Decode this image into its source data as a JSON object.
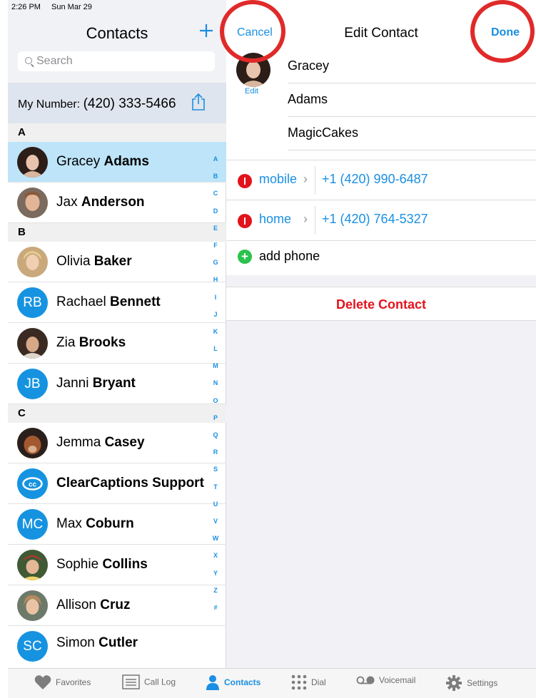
{
  "status_bar": {
    "time": "2:26 PM",
    "date": "Sun Mar 29"
  },
  "left": {
    "title": "Contacts",
    "add_icon": "plus-icon",
    "search_placeholder": "Search",
    "my_number_label": "My Number:",
    "my_number_value": "(420) 333-5466",
    "share_icon": "share-icon",
    "sections": [
      {
        "letter": "A"
      },
      {
        "letter": "B"
      },
      {
        "letter": "C"
      }
    ],
    "contacts": [
      {
        "first": "Gracey",
        "last": "Adams",
        "avatar": "photo",
        "selected": true
      },
      {
        "first": "Jax",
        "last": "Anderson",
        "avatar": "photo"
      },
      {
        "first": "Olivia",
        "last": "Baker",
        "avatar": "photo"
      },
      {
        "first": "Rachael",
        "last": "Bennett",
        "avatar": "RB"
      },
      {
        "first": "Zia",
        "last": "Brooks",
        "avatar": "photo"
      },
      {
        "first": "Janni",
        "last": "Bryant",
        "avatar": "JB"
      },
      {
        "first": "Jemma",
        "last": "Casey",
        "avatar": "photo"
      },
      {
        "first": "",
        "last": "ClearCaptions Support",
        "avatar": "cc-logo"
      },
      {
        "first": "Max",
        "last": "Coburn",
        "avatar": "MC"
      },
      {
        "first": "Sophie",
        "last": "Collins",
        "avatar": "photo"
      },
      {
        "first": "Allison",
        "last": "Cruz",
        "avatar": "photo"
      },
      {
        "first": "Simon",
        "last": "Cutler",
        "avatar": "SC"
      }
    ],
    "index_letters": [
      "A",
      "B",
      "C",
      "D",
      "E",
      "F",
      "G",
      "H",
      "I",
      "J",
      "K",
      "L",
      "M",
      "N",
      "O",
      "P",
      "Q",
      "R",
      "S",
      "T",
      "U",
      "V",
      "W",
      "X",
      "Y",
      "Z",
      "#"
    ]
  },
  "right": {
    "cancel_label": "Cancel",
    "title": "Edit Contact",
    "done_label": "Done",
    "photo_edit_label": "Edit",
    "first_name": "Gracey",
    "last_name": "Adams",
    "company": "MagicCakes",
    "phones": [
      {
        "type": "mobile",
        "number": "+1 (420) 990-6487"
      },
      {
        "type": "home",
        "number": "+1 (420) 764-5327"
      }
    ],
    "add_phone_label": "add phone",
    "delete_label": "Delete Contact"
  },
  "tabs": [
    {
      "label": "Favorites",
      "icon": "heart-icon"
    },
    {
      "label": "Call Log",
      "icon": "call-log-icon"
    },
    {
      "label": "Contacts",
      "icon": "person-icon",
      "active": true
    },
    {
      "label": "Dial",
      "icon": "keypad-icon"
    },
    {
      "label": "Voicemail",
      "icon": "voicemail-icon"
    },
    {
      "label": "Settings",
      "icon": "gear-icon"
    }
  ],
  "colors": {
    "accent": "#1a8fe3",
    "selected_row": "#bde4f9",
    "delete": "#e3131c",
    "highlight_circle": "#e02a2a"
  }
}
